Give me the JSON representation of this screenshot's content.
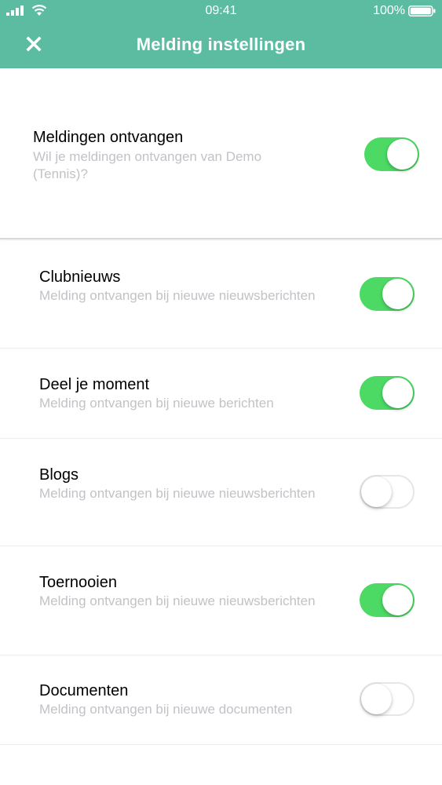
{
  "status_bar": {
    "time": "09:41",
    "battery": "100%"
  },
  "nav": {
    "title": "Melding instellingen",
    "close_icon": "close-icon"
  },
  "master": {
    "title": "Meldingen ontvangen",
    "description": "Wil je meldingen ontvangen van Demo (Tennis)?",
    "enabled": true
  },
  "settings": [
    {
      "title": "Clubnieuws",
      "description": "Melding ontvangen bij nieuwe nieuwsberichten",
      "enabled": true
    },
    {
      "title": "Deel je moment",
      "description": "Melding ontvangen bij nieuwe berichten",
      "enabled": true
    },
    {
      "title": "Blogs",
      "description": "Melding ontvangen bij nieuwe nieuwsberichten",
      "enabled": false
    },
    {
      "title": "Toernooien",
      "description": "Melding ontvangen bij nieuwe nieuwsberichten",
      "enabled": true
    },
    {
      "title": "Documenten",
      "description": "Melding ontvangen bij nieuwe documenten",
      "enabled": false
    }
  ],
  "colors": {
    "header": "#5bbca1",
    "toggle_on": "#4cd964",
    "secondary_text": "#c2c2c7"
  }
}
